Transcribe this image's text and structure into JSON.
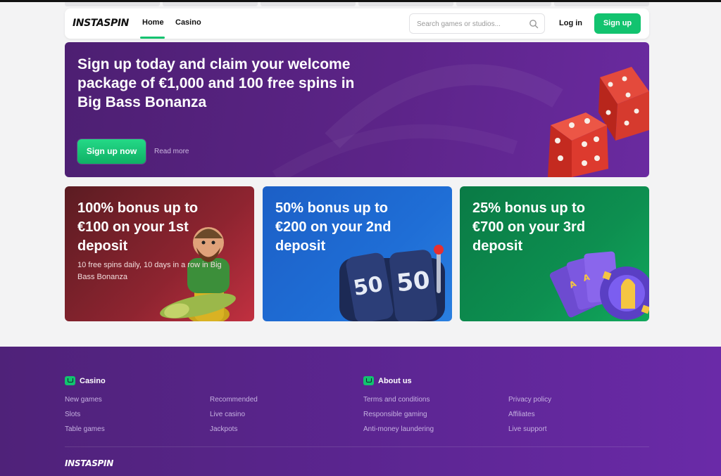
{
  "header": {
    "logo": "INSTASPIN",
    "nav": [
      {
        "label": "Home"
      },
      {
        "label": "Casino"
      }
    ],
    "search_placeholder": "Search games or studios...",
    "login": "Log in",
    "signup": "Sign up"
  },
  "hero": {
    "title": "Sign up today and claim your welcome package of €1,000 and 100 free spins in Big Bass Bonanza",
    "cta": "Sign up now",
    "read_more": "Read more"
  },
  "cards": [
    {
      "title": "100% bonus up to €100 on your 1st deposit",
      "desc": "10 free spins daily, 10 days in a row in Big Bass Bonanza"
    },
    {
      "title": "50% bonus up to €200 on your 2nd deposit",
      "desc": ""
    },
    {
      "title": "25% bonus up to €700 on your 3rd deposit",
      "desc": ""
    }
  ],
  "footer": {
    "casino_heading": "Casino",
    "casino_links": [
      "New games",
      "Slots",
      "Table games",
      "Recommended",
      "Live casino",
      "Jackpots"
    ],
    "about_heading": "About us",
    "about_links": [
      "Terms and conditions",
      "Responsible gaming",
      "Anti-money laundering",
      "Privacy policy",
      "Affiliates",
      "Live support"
    ],
    "logo": "INSTASPIN"
  },
  "colors": {
    "accent": "#12c36f",
    "footer_bg": "#5b2590",
    "hero_bg": "#5c2488"
  }
}
